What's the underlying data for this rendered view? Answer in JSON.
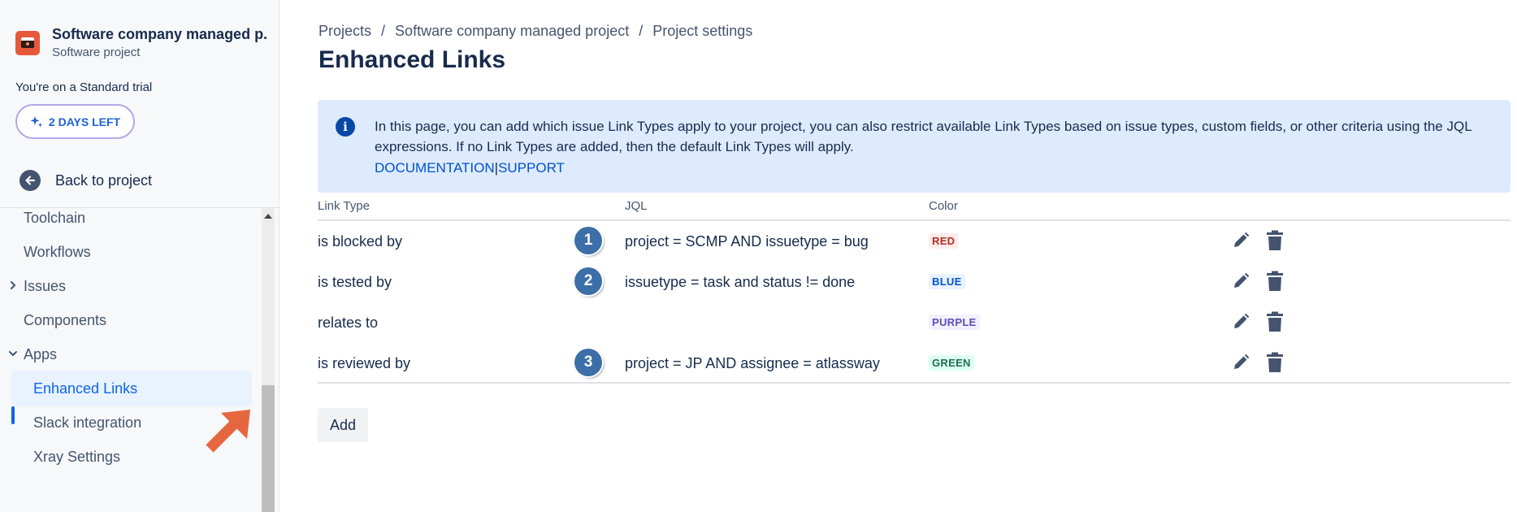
{
  "sidebar": {
    "project_name": "Software company managed p...",
    "project_type": "Software project",
    "trial_text": "You're on a Standard trial",
    "trial_button": "2 DAYS LEFT",
    "back_label": "Back to project",
    "items": [
      {
        "label": "Toolchain"
      },
      {
        "label": "Workflows"
      },
      {
        "label": "Issues"
      },
      {
        "label": "Components"
      },
      {
        "label": "Apps"
      },
      {
        "label": "Enhanced Links"
      },
      {
        "label": "Slack integration"
      },
      {
        "label": "Xray Settings"
      }
    ]
  },
  "breadcrumb": {
    "items": [
      "Projects",
      "Software company managed project",
      "Project settings"
    ],
    "separator": "/"
  },
  "page": {
    "title": "Enhanced Links"
  },
  "info": {
    "text": "In this page, you can add which issue Link Types apply to your project, you can also restrict available Link Types based on issue types, custom fields, or other criteria using the JQL expressions. If no Link Types are added, then the default Link Types will apply.",
    "link_docs": "DOCUMENTATION",
    "link_sep": "|",
    "link_support": "SUPPORT"
  },
  "table": {
    "headers": {
      "link_type": "Link Type",
      "jql": "JQL",
      "color": "Color"
    },
    "rows": [
      {
        "type": "is blocked by",
        "marker": "1",
        "jql": "project = SCMP AND issuetype = bug",
        "color": "RED"
      },
      {
        "type": "is tested by",
        "marker": "2",
        "jql": "issuetype = task and status != done",
        "color": "BLUE"
      },
      {
        "type": "relates to",
        "marker": "",
        "jql": "",
        "color": "PURPLE"
      },
      {
        "type": "is reviewed by",
        "marker": "3",
        "jql": "project = JP AND assignee = atlassway",
        "color": "GREEN"
      }
    ]
  },
  "actions": {
    "add_label": "Add"
  },
  "colors": {
    "red_text": "#ae2e24",
    "red_bg": "#ffeceb",
    "blue_text": "#0055cc",
    "blue_bg": "#e9f2ff",
    "purple_text": "#5e4db2",
    "purple_bg": "#f3f0ff",
    "green_text": "#216e4e",
    "green_bg": "#dcfff1",
    "accent": "#0c66e4",
    "annotation_arrow": "#e5663f",
    "marker": "#3c6ea8"
  },
  "icons": {
    "edit": "pencil-icon",
    "delete": "trash-icon",
    "info": "info-icon",
    "back": "arrow-left-icon",
    "trial": "sparkle-icon",
    "project": "project-icon"
  }
}
